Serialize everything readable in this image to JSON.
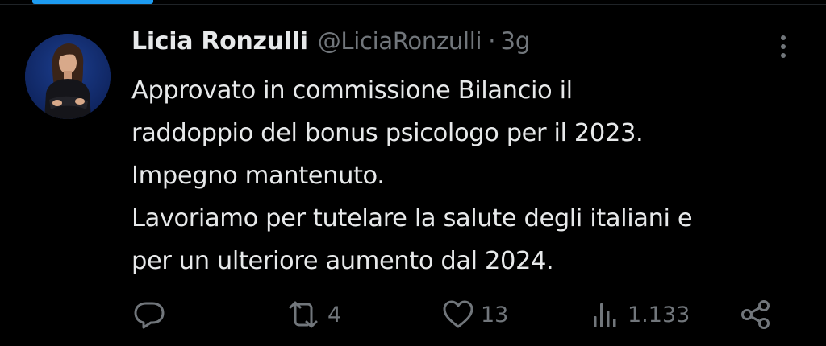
{
  "tweet": {
    "author_name": "Licia Ronzulli",
    "handle": "@LiciaRonzulli",
    "separator": "·",
    "time": "3g",
    "body_lines": [
      "Approvato in commissione Bilancio il",
      "raddoppio del bonus psicologo per il 2023.",
      "Impegno mantenuto.",
      "Lavoriamo per tutelare la salute degli italiani e",
      "per un ulteriore aumento dal 2024."
    ]
  },
  "actions": {
    "reply": {
      "icon": "reply-icon",
      "count": ""
    },
    "retweet": {
      "icon": "retweet-icon",
      "count": "4"
    },
    "like": {
      "icon": "heart-icon",
      "count": "13"
    },
    "views": {
      "icon": "views-icon",
      "count": "1.133"
    },
    "share": {
      "icon": "share-icon"
    }
  },
  "colors": {
    "background": "#000000",
    "primary_text": "#e7e9ea",
    "secondary_text": "#71767b",
    "accent": "#1d9bf0"
  }
}
